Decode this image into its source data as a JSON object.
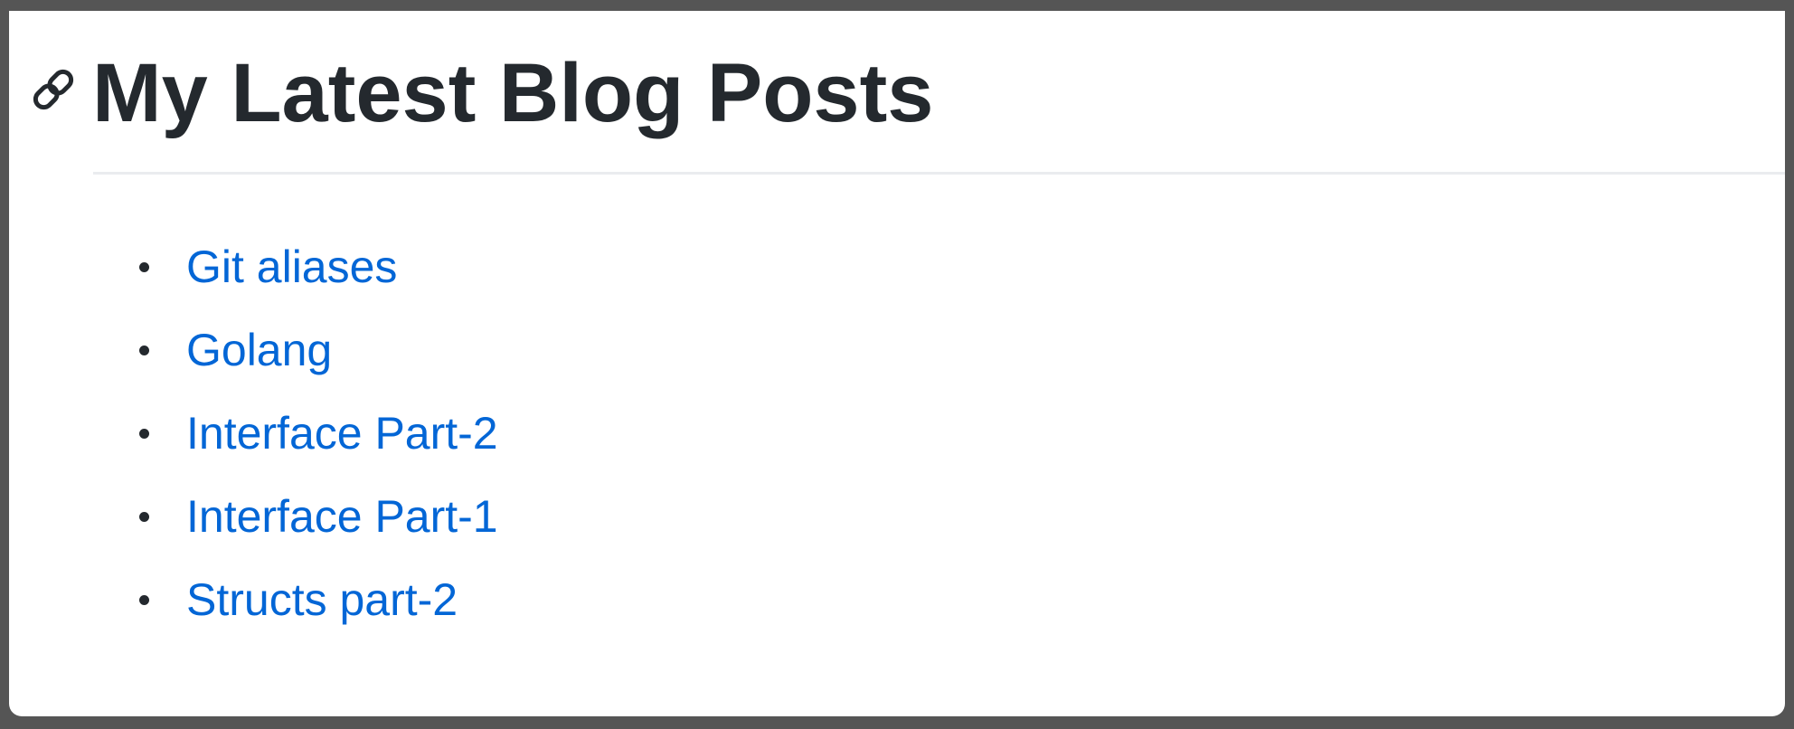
{
  "readme": {
    "heading": {
      "anchor_icon": "link-icon",
      "title": "My Latest Blog Posts"
    },
    "posts": [
      {
        "label": "Git aliases"
      },
      {
        "label": "Golang"
      },
      {
        "label": "Interface Part-2"
      },
      {
        "label": "Interface Part-1"
      },
      {
        "label": "Structs part-2"
      }
    ]
  },
  "colors": {
    "heading_text": "#24292e",
    "link": "#0366d6",
    "rule": "#eaecef",
    "frame_background": "#ffffff",
    "outer_background": "#555555"
  }
}
